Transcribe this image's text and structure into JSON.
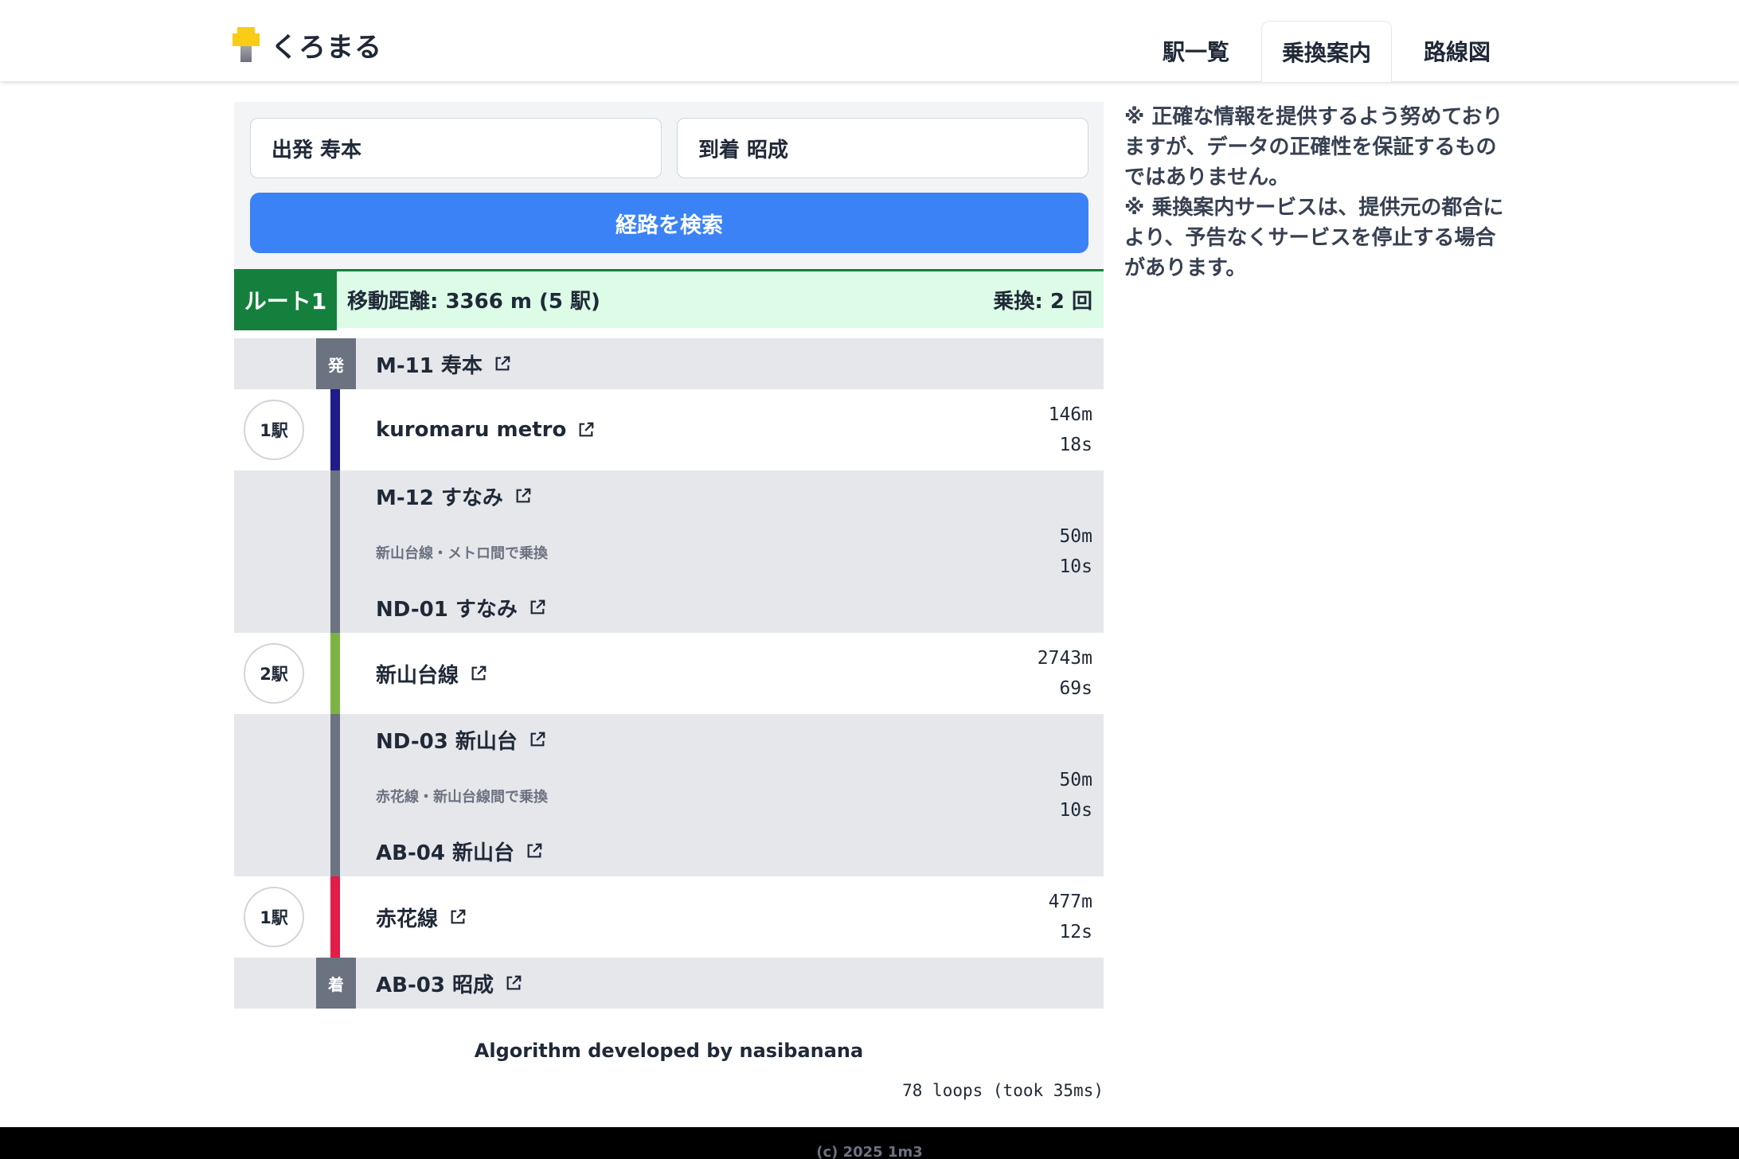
{
  "header": {
    "logo_text": "くろまる",
    "tabs": [
      {
        "label": "駅一覧",
        "active": false
      },
      {
        "label": "乗換案内",
        "active": true
      },
      {
        "label": "路線図",
        "active": false
      }
    ]
  },
  "search": {
    "from_value": "出発  寿本",
    "to_value": "到着  昭成",
    "button_label": "経路を検索"
  },
  "route": {
    "badge": "ルート1",
    "distance": "移動距離: 3366 m (5 駅)",
    "transfers": "乗換: 2 回",
    "depart_tag": "発",
    "arrive_tag": "着",
    "segments": [
      {
        "origin": "M-11  寿本",
        "line": "kuromaru metro",
        "line_color": "#1e1b8a",
        "stops": "1駅",
        "distance": "146m",
        "time": "18s"
      },
      {
        "transfer_from": "M-12  すなみ",
        "note": "新山台線・メトロ間で乗換",
        "transfer_to": "ND-01  すなみ",
        "distance": "50m",
        "time": "10s"
      },
      {
        "line": "新山台線",
        "line_color": "#7cb342",
        "stops": "2駅",
        "distance": "2743m",
        "time": "69s"
      },
      {
        "transfer_from": "ND-03  新山台",
        "note": "赤花線・新山台線間で乗換",
        "transfer_to": "AB-04  新山台",
        "distance": "50m",
        "time": "10s"
      },
      {
        "line": "赤花線",
        "line_color": "#e11d48",
        "stops": "1駅",
        "distance": "477m",
        "time": "12s",
        "destination": "AB-03  昭成"
      }
    ]
  },
  "notice": {
    "line1": "※ 正確な情報を提供するよう努めておりますが、データの正確性を保証するものではありません。",
    "line2": "※ 乗換案内サービスは、提供元の都合により、予告なくサービスを停止する場合があります。"
  },
  "credit": "Algorithm developed by nasibanana",
  "loops": "78 loops (took 35ms)",
  "footer": "(c) 2025 1m3",
  "colors": {
    "transfer_bar": "#6b7280",
    "accent": "#3b82f6",
    "route_green": "#15803d"
  }
}
